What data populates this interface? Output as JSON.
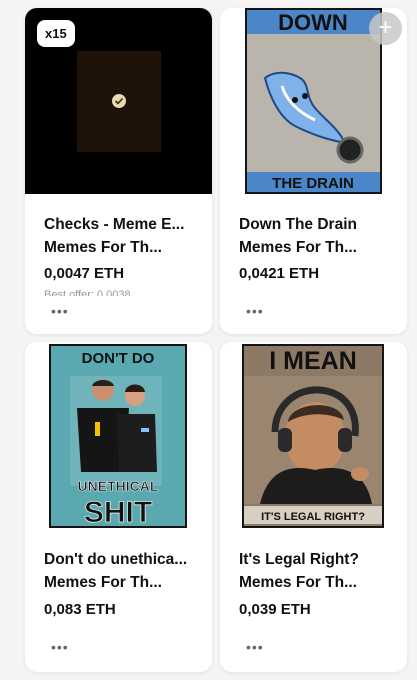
{
  "cards": [
    {
      "badge": "x15",
      "title": "Checks - Meme E...",
      "collection": "Memes For Th...",
      "price": "0,0047 ETH",
      "offer": "Best offer: 0,0038",
      "more_icon": "more-dots-icon"
    },
    {
      "title": "Down The Drain",
      "collection": "Memes For Th...",
      "price": "0,0421 ETH",
      "poster_top": "DOWN",
      "poster_bottom": "THE DRAIN",
      "more_icon": "more-dots-icon"
    },
    {
      "title": "Don't do unethica...",
      "collection": "Memes For Th...",
      "price": "0,083 ETH",
      "poster_top": "DON'T DO",
      "poster_mid": "UNETHICAL",
      "poster_bottom": "SHIT",
      "more_icon": "more-dots-icon"
    },
    {
      "title": "It's Legal Right?",
      "collection": "Memes For Th...",
      "price": "0,039 ETH",
      "poster_top": "I MEAN",
      "poster_bottom": "IT'S LEGAL RIGHT?",
      "more_icon": "more-dots-icon"
    }
  ],
  "add_button": "+",
  "more_glyph": "•••"
}
